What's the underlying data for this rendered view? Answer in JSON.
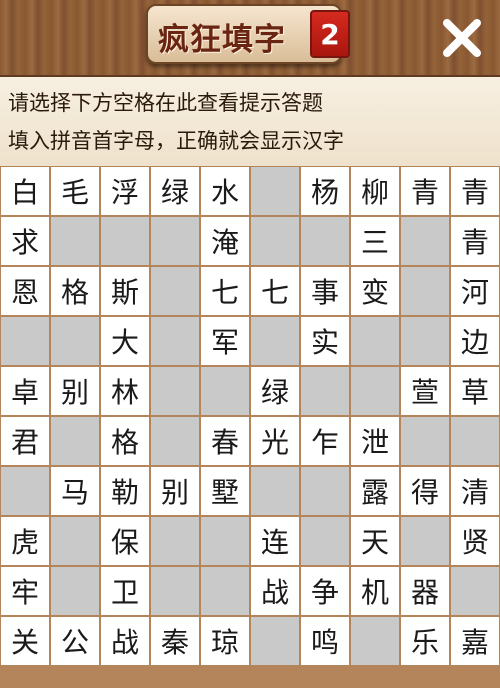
{
  "header": {
    "title": "疯狂填字",
    "badge": "2",
    "close_icon": "close-icon"
  },
  "hints": {
    "line1": "请选择下方空格在此查看提示答题",
    "line2": "填入拼音首字母，正确就会显示汉字"
  },
  "colors": {
    "wood": "#8b5a34",
    "cell_filled": "#ffffff",
    "cell_empty": "#c9c9c9",
    "badge_red": "#c0201a"
  },
  "grid": [
    [
      "白",
      "毛",
      "浮",
      "绿",
      "水",
      "",
      "杨",
      "柳",
      "青",
      "青"
    ],
    [
      "求",
      "",
      "",
      "",
      "淹",
      "",
      "",
      "三",
      "",
      "青"
    ],
    [
      "恩",
      "格",
      "斯",
      "",
      "七",
      "七",
      "事",
      "变",
      "",
      "河"
    ],
    [
      "",
      "",
      "大",
      "",
      "军",
      "",
      "实",
      "",
      "",
      "边"
    ],
    [
      "卓",
      "别",
      "林",
      "",
      "",
      "绿",
      "",
      "",
      "萱",
      "草"
    ],
    [
      "君",
      "",
      "格",
      "",
      "春",
      "光",
      "乍",
      "泄",
      "",
      ""
    ],
    [
      "",
      "马",
      "勒",
      "别",
      "墅",
      "",
      "",
      "露",
      "得",
      "清"
    ],
    [
      "虎",
      "",
      "保",
      "",
      "",
      "连",
      "",
      "天",
      "",
      "贤"
    ],
    [
      "牢",
      "",
      "卫",
      "",
      "",
      "战",
      "争",
      "机",
      "器",
      ""
    ],
    [
      "关",
      "公",
      "战",
      "秦",
      "琼",
      "",
      "鸣",
      "",
      "乐",
      "嘉"
    ]
  ]
}
